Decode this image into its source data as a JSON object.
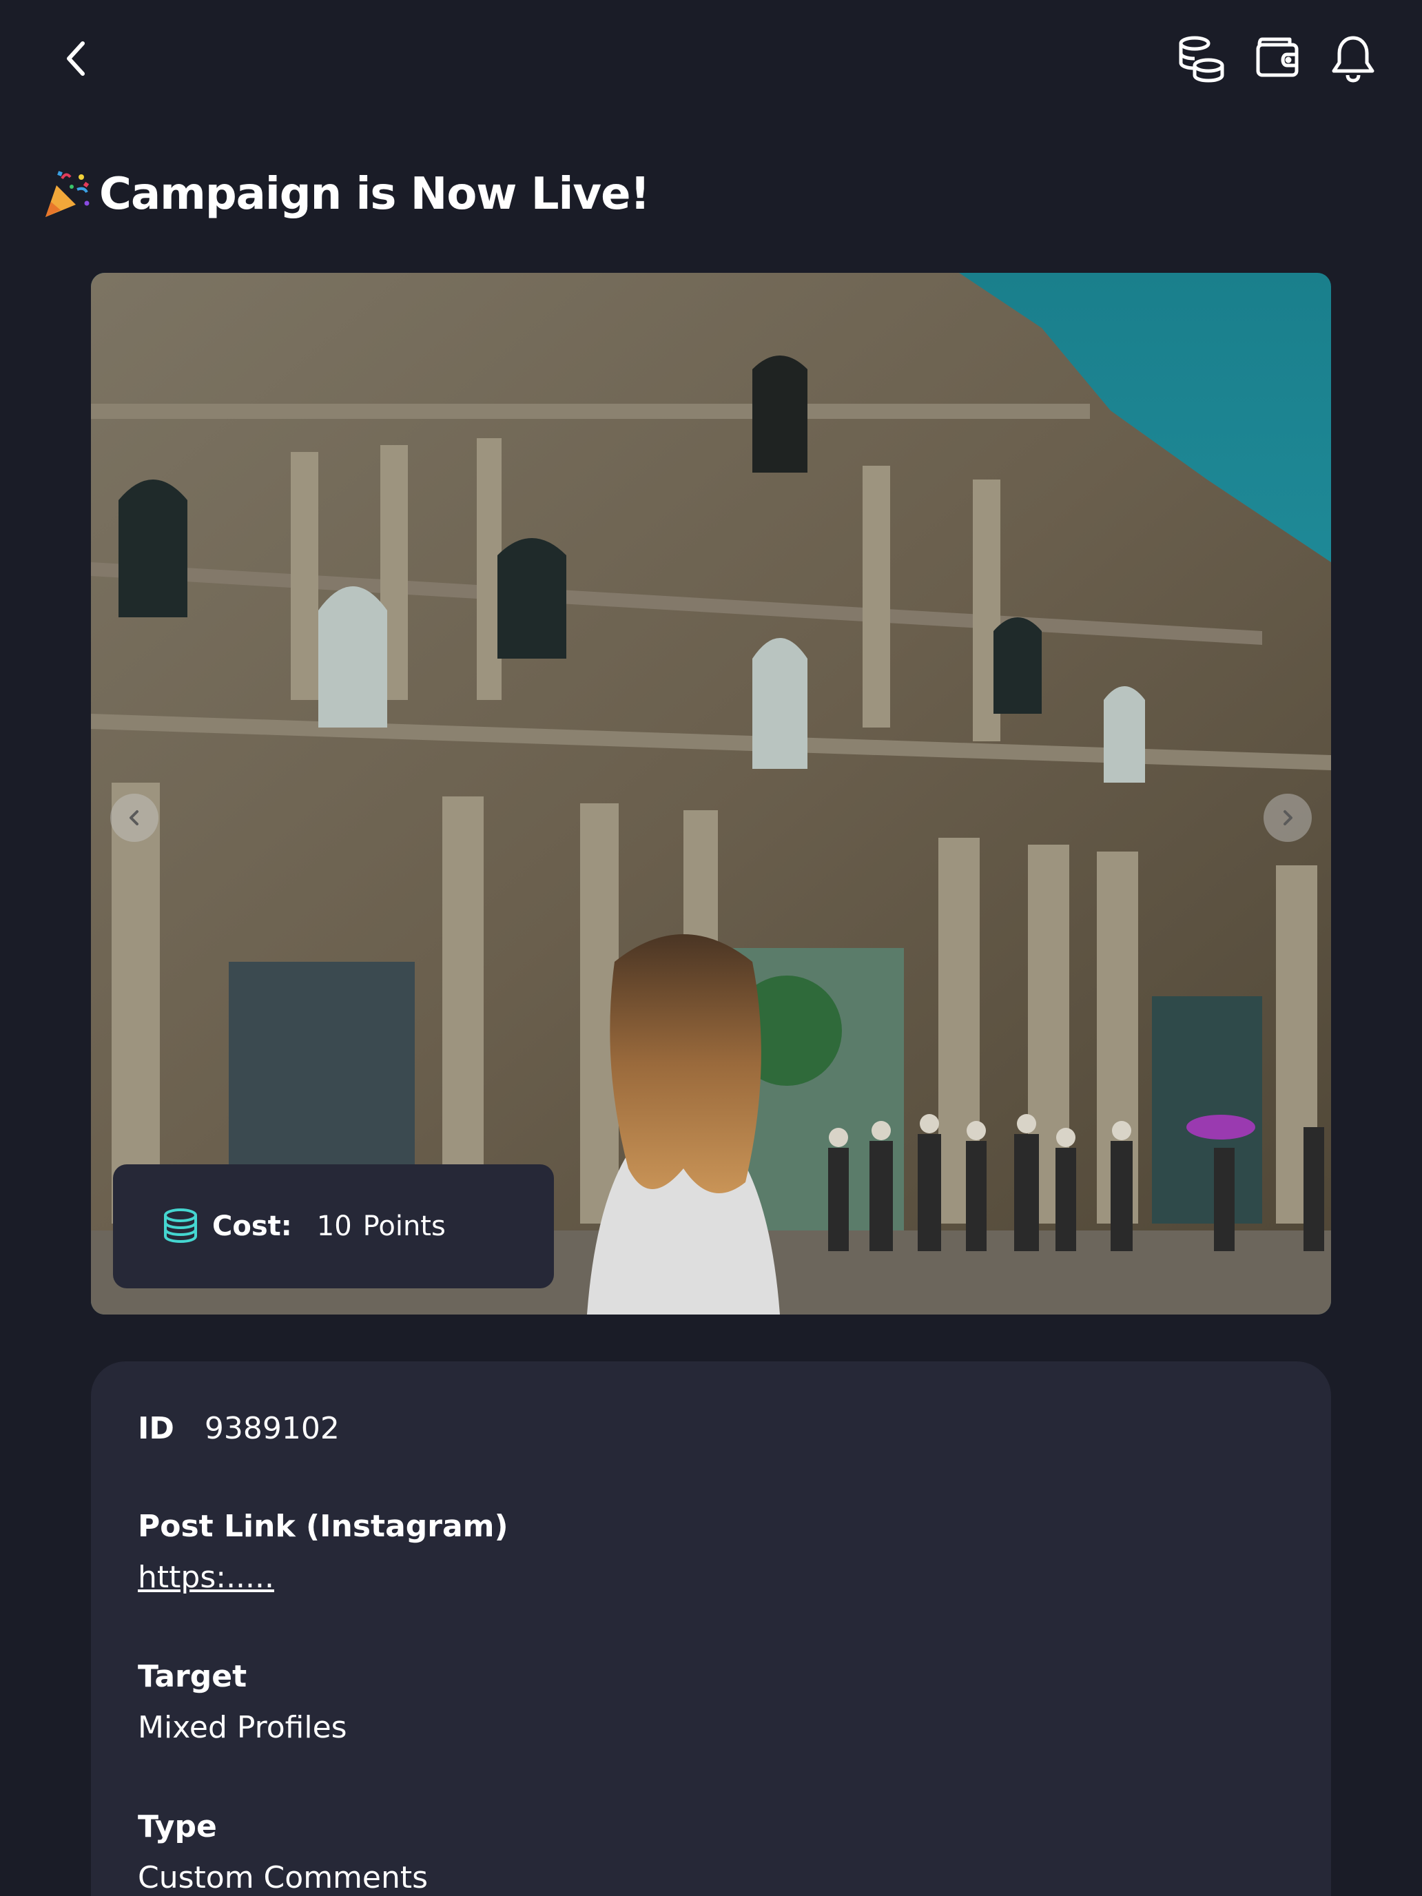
{
  "header": {
    "back_icon": "chevron-left-icon",
    "icons": [
      "coins-icon",
      "wallet-icon",
      "bell-icon"
    ]
  },
  "title": "Campaign is Now Live!",
  "title_icon": "party-popper-icon",
  "hero": {
    "cost_label": "Cost:",
    "cost_value": "10",
    "cost_unit": "Points",
    "accent": "#45d6d0"
  },
  "details": {
    "id_label": "ID",
    "id_value": "9389102",
    "post_link_label": "Post Link (Instagram)",
    "post_link_value": "https:.....",
    "target_label": "Target",
    "target_value": "Mixed Profiles",
    "type_label": "Type",
    "type_value": "Custom Comments"
  },
  "colors": {
    "background": "#1a1c27",
    "card": "#262837"
  }
}
